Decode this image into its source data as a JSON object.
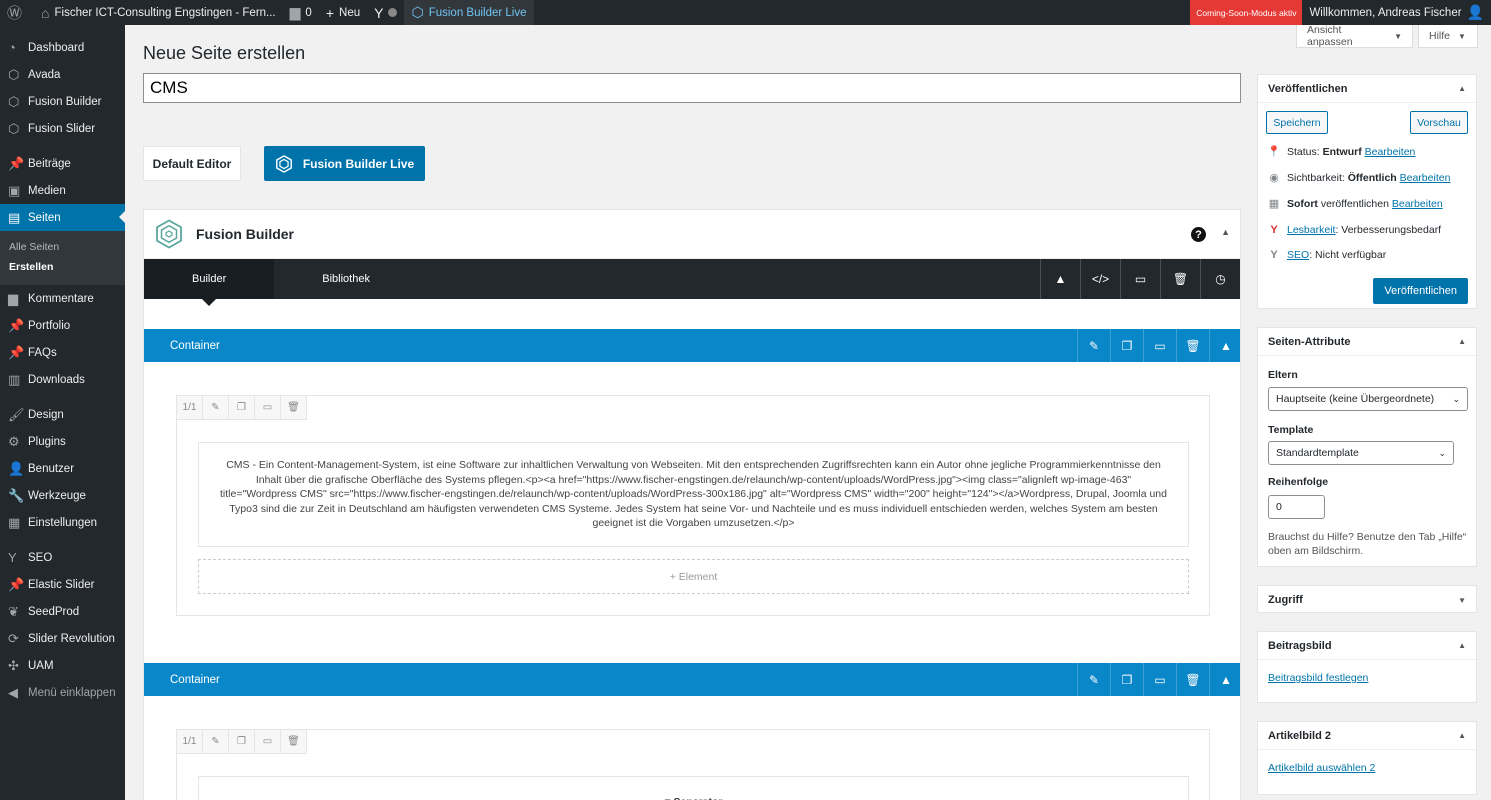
{
  "adminbar": {
    "site_name": "Fischer ICT-Consulting Engstingen - Fern...",
    "comments_count": "0",
    "new_label": "Neu",
    "fusion_builder_live": "Fusion Builder Live",
    "coming_soon": "Coming-Soon-Modus aktiv",
    "welcome": "Willkommen, Andreas Fischer"
  },
  "sidebar": {
    "items": [
      {
        "label": "Dashboard",
        "icon": "dashboard-icon"
      },
      {
        "label": "Avada",
        "icon": "avada-icon"
      },
      {
        "label": "Fusion Builder",
        "icon": "fusion-builder-icon"
      },
      {
        "label": "Fusion Slider",
        "icon": "fusion-slider-icon"
      },
      {
        "label": "Beiträge",
        "icon": "pin-icon"
      },
      {
        "label": "Medien",
        "icon": "media-icon"
      },
      {
        "label": "Seiten",
        "icon": "pages-icon"
      },
      {
        "label": "Kommentare",
        "icon": "comments-icon"
      },
      {
        "label": "Portfolio",
        "icon": "pin-icon"
      },
      {
        "label": "FAQs",
        "icon": "pin-icon"
      },
      {
        "label": "Downloads",
        "icon": "downloads-icon"
      },
      {
        "label": "Design",
        "icon": "design-icon"
      },
      {
        "label": "Plugins",
        "icon": "plugins-icon"
      },
      {
        "label": "Benutzer",
        "icon": "users-icon"
      },
      {
        "label": "Werkzeuge",
        "icon": "tools-icon"
      },
      {
        "label": "Einstellungen",
        "icon": "settings-icon"
      },
      {
        "label": "SEO",
        "icon": "yoast-icon"
      },
      {
        "label": "Elastic Slider",
        "icon": "pin-icon"
      },
      {
        "label": "SeedProd",
        "icon": "seedprod-icon"
      },
      {
        "label": "Slider Revolution",
        "icon": "revslider-icon"
      },
      {
        "label": "UAM",
        "icon": "uam-icon"
      },
      {
        "label": "Menü einklappen",
        "icon": "collapse-icon"
      }
    ],
    "submenu": [
      "Alle Seiten",
      "Erstellen"
    ]
  },
  "top_buttons": {
    "screen_options": "Ansicht anpassen",
    "help": "Hilfe"
  },
  "page": {
    "heading": "Neue Seite erstellen",
    "title_value": "CMS",
    "default_editor": "Default Editor",
    "fusion_builder_live": "Fusion Builder Live"
  },
  "fusion_builder": {
    "title": "Fusion Builder",
    "tabs": [
      "Builder",
      "Bibliothek"
    ],
    "container_label": "Container",
    "column_size": "1/1",
    "text_content": "CMS - Ein Content-Management-System, ist eine Software zur inhaltlichen Verwaltung von Webseiten. Mit den entsprechenden Zugriffsrechten kann ein Autor ohne jegliche Programmierkenntnisse den Inhalt über die grafische Oberfläche des Systems pflegen.<p><a href=\"https://www.fischer-engstingen.de/relaunch/wp-content/uploads/WordPress.jpg\"><img class=\"alignleft wp-image-463\" title=\"Wordpress CMS\" src=\"https://www.fischer-engstingen.de/relaunch/wp-content/uploads/WordPress-300x186.jpg\" alt=\"Wordpress CMS\" width=\"200\" height=\"124\"></a>Wordpress, Drupal, Joomla und Typo3 sind die zur Zeit in Deutschland am häufigsten verwendeten CMS Systeme. Jedes System hat seine Vor- und Nachteile und es muss individuell entschieden werden, welches System am besten geeignet ist die Vorgaben umzusetzen.</p>",
    "add_element": "+ Element",
    "separator": "= Separator"
  },
  "publish": {
    "title": "Veröffentlichen",
    "save": "Speichern",
    "preview": "Vorschau",
    "status_label": "Status:",
    "status_value": "Entwurf",
    "visibility_label": "Sichtbarkeit:",
    "visibility_value": "Öffentlich",
    "publish_time_bold": "Sofort",
    "publish_time_rest": "veröffentlichen",
    "edit": "Bearbeiten",
    "readability_link": "Lesbarkeit",
    "readability_value": ": Verbesserungsbedarf",
    "seo_link": "SEO",
    "seo_value": ": Nicht verfügbar",
    "publish_button": "Veröffentlichen"
  },
  "page_attributes": {
    "title": "Seiten-Attribute",
    "parent_label": "Eltern",
    "parent_value": "Hauptseite (keine Übergeordnete)",
    "template_label": "Template",
    "template_value": "Standardtemplate",
    "order_label": "Reihenfolge",
    "order_value": "0",
    "help_text": "Brauchst du Hilfe? Benutze den Tab „Hilfe“ oben am Bildschirm."
  },
  "access": {
    "title": "Zugriff"
  },
  "featured_image": {
    "title": "Beitragsbild",
    "link": "Beitragsbild festlegen"
  },
  "article_image2": {
    "title": "Artikelbild 2",
    "link": "Artikelbild auswählen 2"
  }
}
